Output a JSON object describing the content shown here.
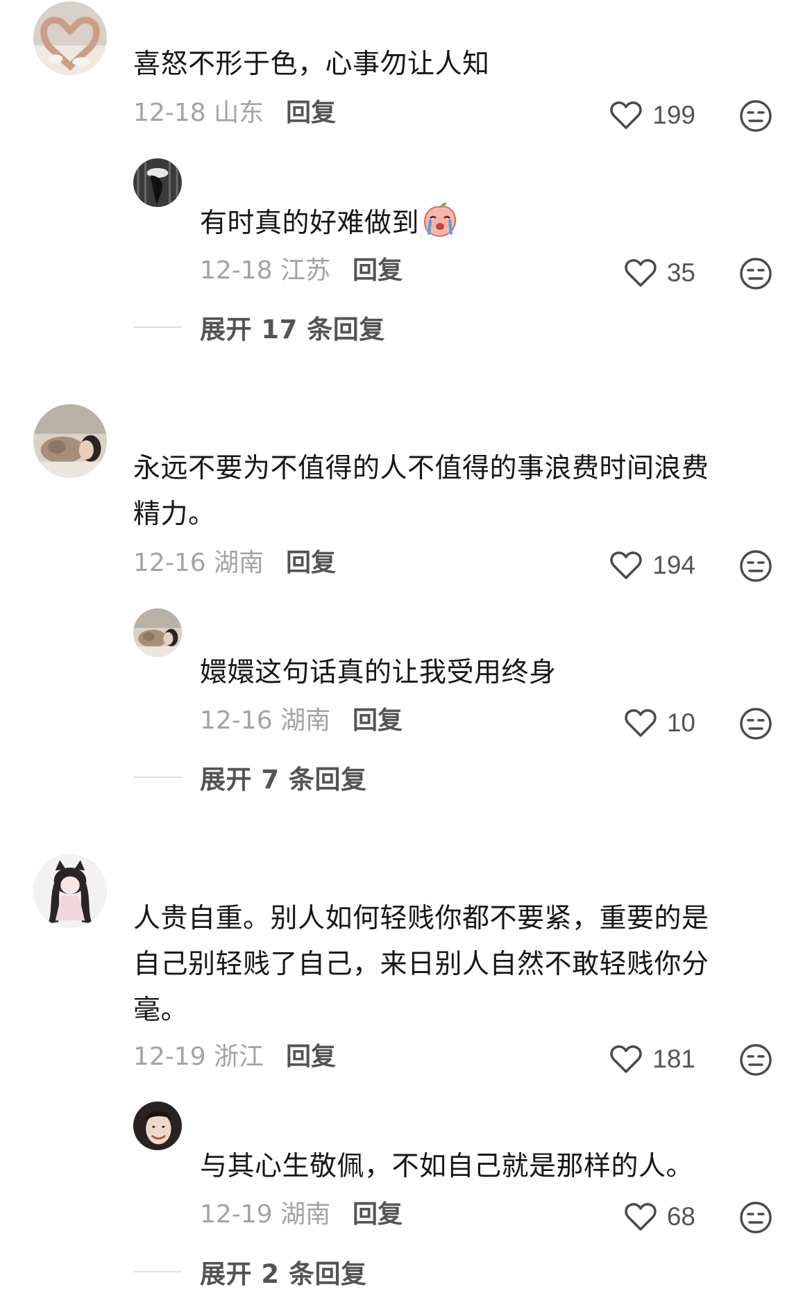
{
  "threads": [
    {
      "comment": {
        "avatar": "heart-hands-avatar",
        "text": "喜怒不形于色，心事勿让人知",
        "date": "12-18",
        "location": "山东",
        "reply_label": "回复",
        "likes": "199"
      },
      "reply": {
        "avatar": "dark-figure-avatar",
        "text": "有时真的好难做到",
        "emoji": "crying-peach-emoji",
        "date": "12-18",
        "location": "江苏",
        "reply_label": "回复",
        "likes": "35"
      },
      "expand_label": "展开 17 条回复"
    },
    {
      "comment": {
        "avatar": "sleeping-woman-cat-avatar",
        "text_lines": [
          "永远不要为不值得的人不值得的事浪费时间浪费",
          "精力。"
        ],
        "date": "12-16",
        "location": "湖南",
        "reply_label": "回复",
        "likes": "194"
      },
      "reply": {
        "avatar": "sleeping-woman-cat-avatar",
        "text": "嬛嬛这句话真的让我受用终身",
        "date": "12-16",
        "location": "湖南",
        "reply_label": "回复",
        "likes": "10"
      },
      "expand_label": "展开 7 条回复"
    },
    {
      "comment": {
        "avatar": "anime-cat-girl-avatar",
        "text_lines": [
          "人贵自重。别人如何轻贱你都不要紧，重要的是",
          "自己别轻贱了自己，来日别人自然不敢轻贱你分",
          "毫。"
        ],
        "date": "12-19",
        "location": "浙江",
        "reply_label": "回复",
        "likes": "181"
      },
      "reply": {
        "avatar": "smiling-woman-avatar",
        "text": "与其心生敬佩，不如自己就是那样的人。",
        "date": "12-19",
        "location": "湖南",
        "reply_label": "回复",
        "likes": "68"
      },
      "expand_label": "展开 2 条回复"
    }
  ],
  "icons": {
    "like": "heart-outline-icon",
    "dislike": "unamused-face-icon"
  },
  "colors": {
    "text_primary": "#161616",
    "text_meta": "#a3a3a3",
    "text_action": "#545454",
    "divider": "#dedede"
  }
}
